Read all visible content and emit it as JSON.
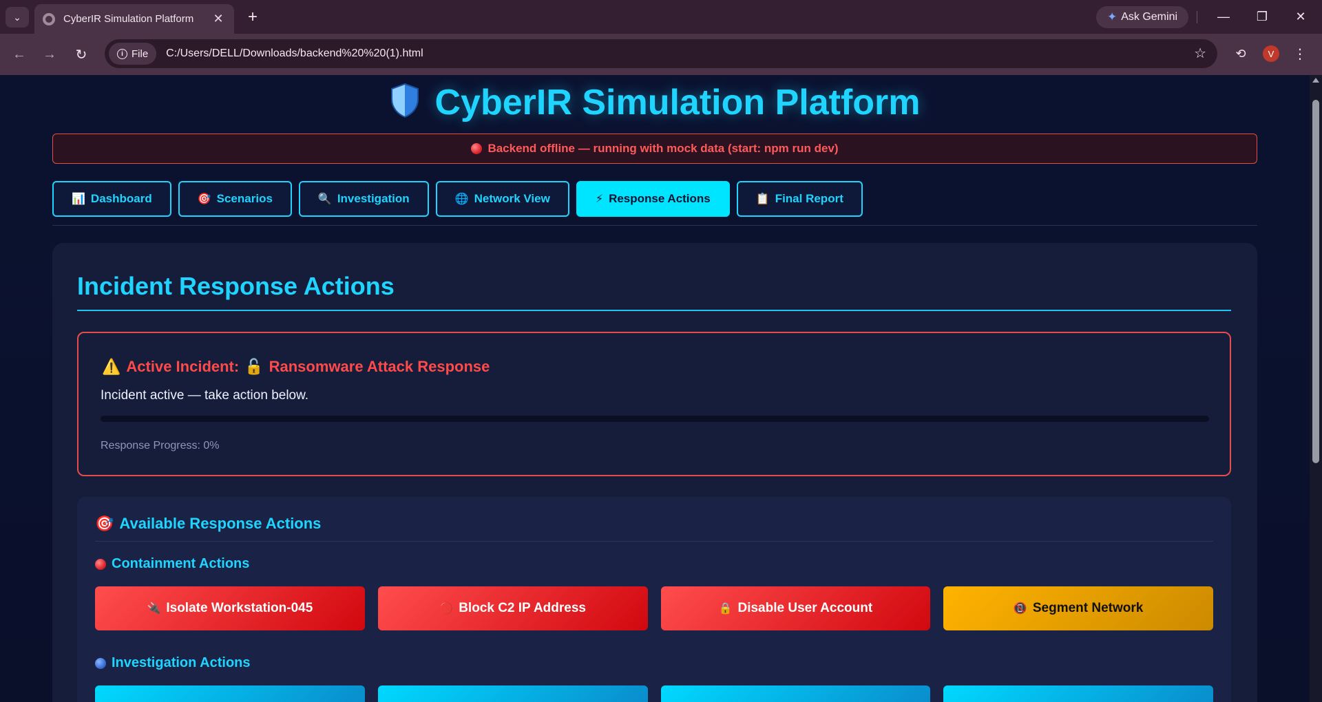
{
  "browser": {
    "tab_title": "CyberIR Simulation Platform",
    "new_tab": "+",
    "gemini_label": "Ask Gemini",
    "file_chip": "File",
    "url": "C:/Users/DELL/Downloads/backend%20%20(1).html",
    "profile_initial": "V"
  },
  "header": {
    "title": "CyberIR Simulation Platform"
  },
  "alert": {
    "text": "Backend offline — running with mock data (start: npm run dev)"
  },
  "nav": {
    "tabs": [
      {
        "label": "Dashboard",
        "icon": "bar-chart-icon",
        "glyph": "📊"
      },
      {
        "label": "Scenarios",
        "icon": "target-icon",
        "glyph": "🎯"
      },
      {
        "label": "Investigation",
        "icon": "magnifier-icon",
        "glyph": "🔍"
      },
      {
        "label": "Network View",
        "icon": "globe-icon",
        "glyph": "🌐"
      },
      {
        "label": "Response Actions",
        "icon": "lightning-icon",
        "glyph": "⚡",
        "active": true
      },
      {
        "label": "Final Report",
        "icon": "clipboard-icon",
        "glyph": "📋"
      }
    ]
  },
  "main": {
    "section_title": "Incident Response Actions",
    "incident": {
      "prefix": "Active Incident:",
      "name": "Ransomware Attack Response",
      "status_text": "Incident active — take action below.",
      "progress_label": "Response Progress: 0%",
      "progress_fraction": 0
    },
    "actions": {
      "title": "Available Response Actions",
      "containment": {
        "title": "Containment Actions",
        "buttons": [
          {
            "label": "Isolate Workstation-045",
            "icon": "unplug-icon",
            "glyph": "🔌"
          },
          {
            "label": "Block C2 IP Address",
            "icon": "prohibited-icon",
            "glyph": "🚫"
          },
          {
            "label": "Disable User Account",
            "icon": "lock-icon",
            "glyph": "🔒"
          },
          {
            "label": "Segment Network",
            "icon": "no-entry-icon",
            "glyph": "📵"
          }
        ]
      },
      "investigation": {
        "title": "Investigation Actions"
      }
    }
  },
  "colors": {
    "accent": "#1fd5ff",
    "danger": "#e74c4c",
    "warning": "#ffb300",
    "background": "#0b1128"
  }
}
